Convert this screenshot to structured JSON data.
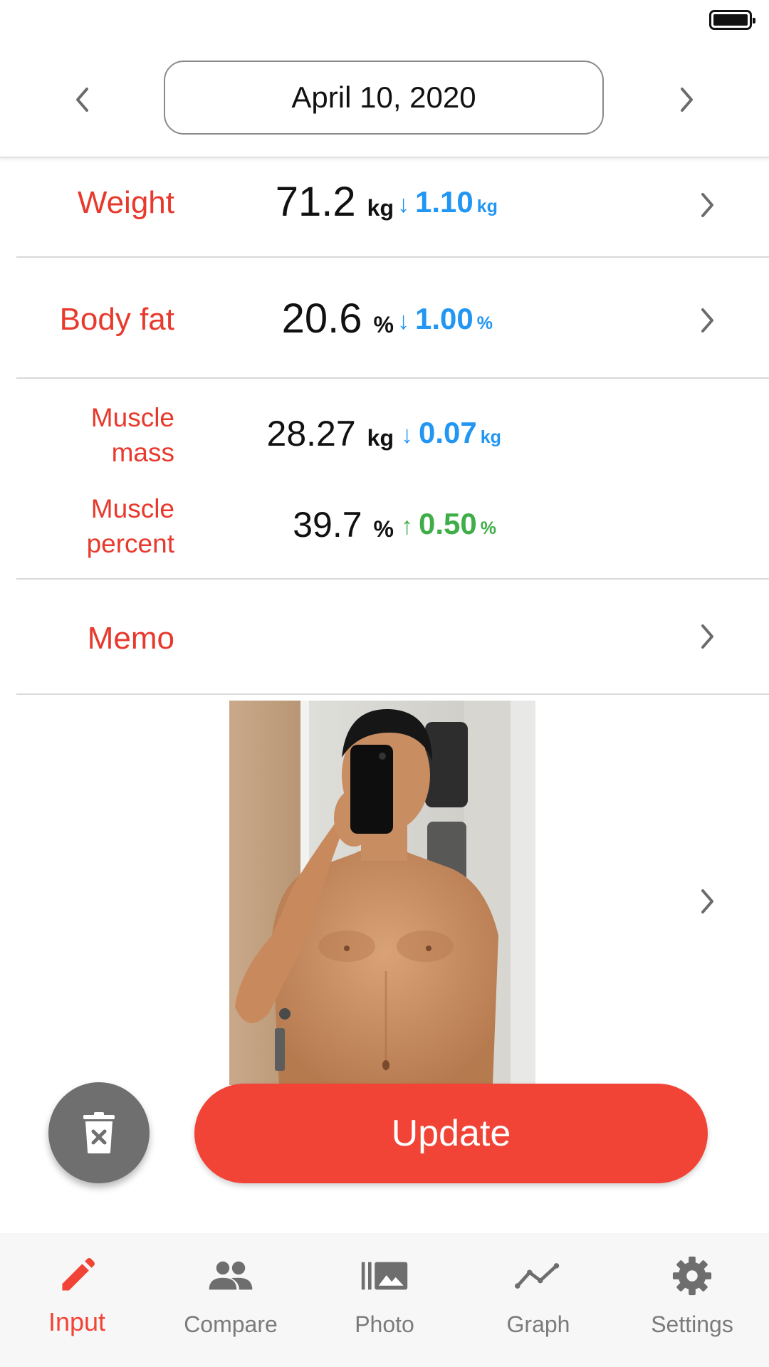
{
  "date_header": {
    "date": "April 10, 2020",
    "prev_icon": "chevron-left-icon",
    "next_icon": "chevron-right-icon"
  },
  "metrics": {
    "weight": {
      "label": "Weight",
      "value": "71.2",
      "unit": "kg",
      "change_direction": "down",
      "change_value": "1.10",
      "change_unit": "kg"
    },
    "body_fat": {
      "label": "Body fat",
      "value": "20.6",
      "unit": "%",
      "change_direction": "down",
      "change_value": "1.00",
      "change_unit": "%"
    },
    "muscle_mass": {
      "label_line1": "Muscle",
      "label_line2": "mass",
      "value": "28.27",
      "unit": "kg",
      "change_direction": "down",
      "change_value": "0.07",
      "change_unit": "kg"
    },
    "muscle_percent": {
      "label_line1": "Muscle",
      "label_line2": "percent",
      "value": "39.7",
      "unit": "%",
      "change_direction": "up",
      "change_value": "0.50",
      "change_unit": "%"
    }
  },
  "memo": {
    "label": "Memo",
    "value": ""
  },
  "actions": {
    "update_label": "Update",
    "delete_icon": "trash-icon"
  },
  "bottom_nav": {
    "tabs": [
      {
        "label": "Input",
        "icon": "pencil-icon",
        "active": true
      },
      {
        "label": "Compare",
        "icon": "people-icon",
        "active": false
      },
      {
        "label": "Photo",
        "icon": "photo-library-icon",
        "active": false
      },
      {
        "label": "Graph",
        "icon": "line-chart-icon",
        "active": false
      },
      {
        "label": "Settings",
        "icon": "gear-icon",
        "active": false
      }
    ]
  },
  "colors": {
    "accent_red": "#f14336",
    "label_red": "#e8392d",
    "decrease_blue": "#2196f3",
    "increase_green": "#3fae49"
  }
}
